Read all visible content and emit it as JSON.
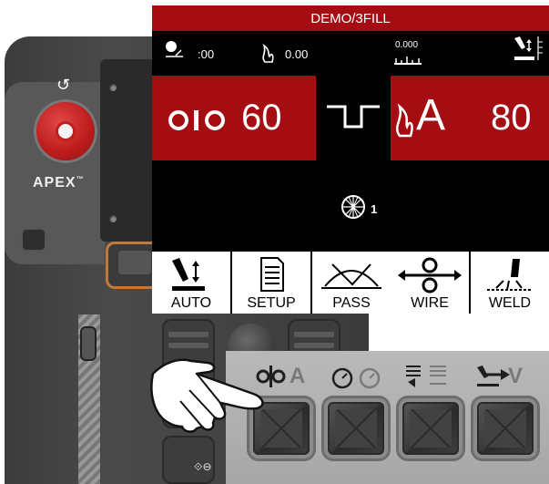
{
  "display": {
    "title": "DEMO/3FILL",
    "status": {
      "timer_value": ":00",
      "heat_value": "0.00",
      "offset_value": "0.000"
    },
    "left_panel": {
      "icon": "wire-feed-rollers-icon",
      "value": "60"
    },
    "center_icon": "waveform-pulse-icon",
    "right_panel": {
      "unit": "A",
      "icon": "arc-flame-icon",
      "value": "80"
    },
    "pass": {
      "icon": "pass-wheel-icon",
      "count": "1"
    },
    "menu": [
      {
        "label": "AUTO",
        "icon": "torch-auto-icon"
      },
      {
        "label": "SETUP",
        "icon": "document-setup-icon"
      },
      {
        "label": "PASS",
        "icon": "pass-arc-icon"
      },
      {
        "label": "WIRE",
        "icon": "wire-feed-icon"
      },
      {
        "label": "WELD",
        "icon": "weld-torch-icon"
      }
    ],
    "colors": {
      "accent_red": "#a50d12",
      "screen_bg": "#000000",
      "menu_bg": "#ffffff"
    }
  },
  "pendant": {
    "brand": "APEX",
    "trademark": "™"
  },
  "inset": {
    "keys": [
      {
        "icon": "current-adjust-icon",
        "text": "A"
      },
      {
        "icon": "timer-r-icon"
      },
      {
        "icon": "list-toggle-icon"
      },
      {
        "icon": "voltage-arrow-icon",
        "text": "V"
      }
    ],
    "colors": {
      "key_dark": "#3a3a3a",
      "inset_bg": "#b1b1b1"
    }
  }
}
